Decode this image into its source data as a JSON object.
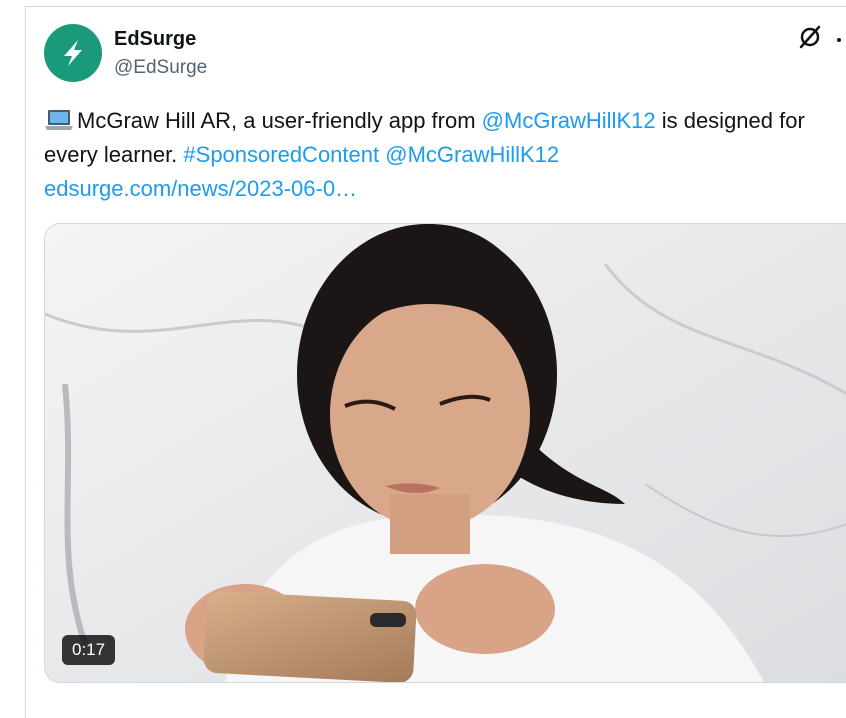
{
  "tweet": {
    "author_name": "EdSurge",
    "author_handle": "@EdSurge",
    "text": {
      "emoji": "laptop-icon",
      "part1": "McGraw Hill AR, a user-friendly app from ",
      "mention1": "@McGrawHillK12",
      "part2": " is designed for every learner. ",
      "hashtag": "#SponsoredContent",
      "part3": " ",
      "mention2": "@McGrawHillK12",
      "part4": " ",
      "link": "edsurge.com/news/2023-06-0…"
    },
    "media": {
      "duration": "0:17"
    }
  },
  "colors": {
    "accent": "#1d9bf0",
    "avatar_bg": "#1a9a7b",
    "text": "#0f1419",
    "muted": "#536471"
  }
}
